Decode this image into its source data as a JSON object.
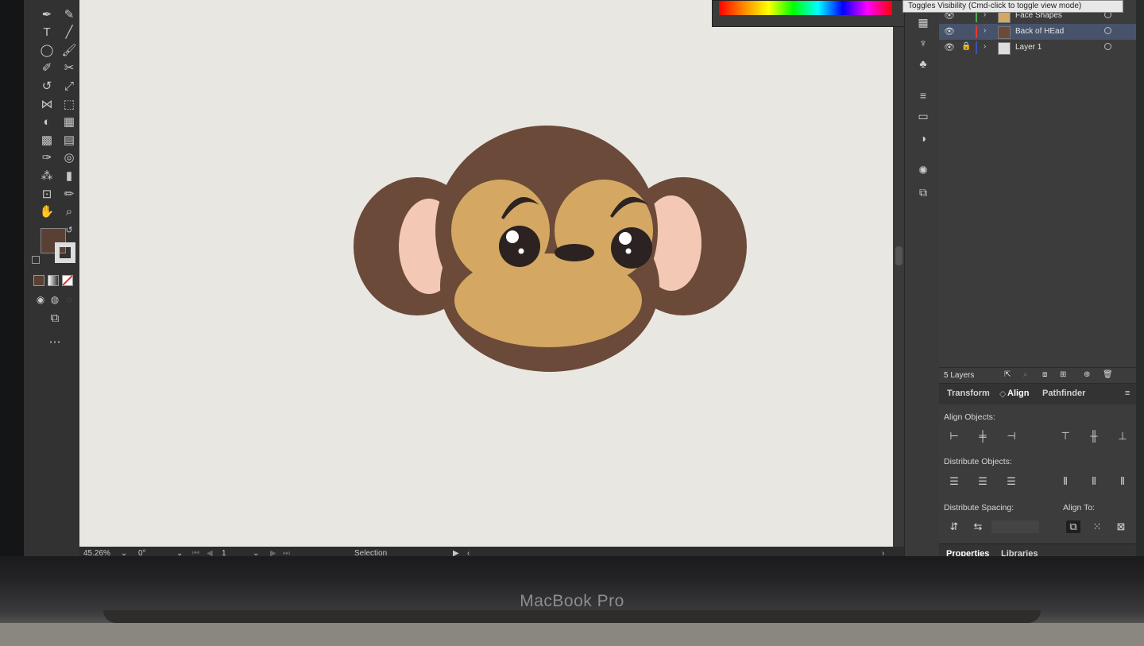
{
  "device": {
    "brand": "MacBook Pro"
  },
  "tooltip": {
    "text": "Toggles Visibility (Cmd-click to toggle view mode)"
  },
  "tools": [
    {
      "name": "pen-icon",
      "glyph": "✒"
    },
    {
      "name": "curvature-icon",
      "glyph": "✎"
    },
    {
      "name": "type-icon",
      "glyph": "T"
    },
    {
      "name": "line-icon",
      "glyph": "╱"
    },
    {
      "name": "ellipse-icon",
      "glyph": "◯"
    },
    {
      "name": "paintbrush-icon",
      "glyph": "🖌"
    },
    {
      "name": "shaper-icon",
      "glyph": "✐"
    },
    {
      "name": "scissors-icon",
      "glyph": "✂"
    },
    {
      "name": "rotate-icon",
      "glyph": "↺"
    },
    {
      "name": "scale-icon",
      "glyph": "⤢"
    },
    {
      "name": "width-icon",
      "glyph": "⋈"
    },
    {
      "name": "free-transform-icon",
      "glyph": "⬚"
    },
    {
      "name": "shape-builder-icon",
      "glyph": "◐"
    },
    {
      "name": "perspective-icon",
      "glyph": "▦"
    },
    {
      "name": "mesh-icon",
      "glyph": "▩"
    },
    {
      "name": "gradient-icon",
      "glyph": "▤"
    },
    {
      "name": "eyedropper-icon",
      "glyph": "✑"
    },
    {
      "name": "blend-icon",
      "glyph": "◎"
    },
    {
      "name": "symbol-sprayer-icon",
      "glyph": "⁂"
    },
    {
      "name": "graph-icon",
      "glyph": "▮"
    },
    {
      "name": "artboard-icon",
      "glyph": "⊡"
    },
    {
      "name": "slice-icon",
      "glyph": "✏"
    },
    {
      "name": "hand-icon",
      "glyph": "✋"
    },
    {
      "name": "zoom-icon",
      "glyph": "⌕"
    }
  ],
  "colors": {
    "fill": "#5a4034",
    "head": "#6b4a3a",
    "face": "#d4a862",
    "ear_inner": "#f3c8b4",
    "eye": "#2b2221",
    "canvas": "#e9e7e2"
  },
  "status": {
    "zoom": "45.26%",
    "rotation": "0°",
    "artboard": "1",
    "tool": "Selection"
  },
  "layers": {
    "items": [
      {
        "name": "Face Shapes",
        "color": "#4caf50",
        "selected": false,
        "locked": false
      },
      {
        "name": "Back of HEad",
        "color": "#e53935",
        "selected": true,
        "locked": false
      },
      {
        "name": "Layer 1",
        "color": "#3f51b5",
        "selected": false,
        "locked": true
      }
    ],
    "count_label": "5 Layers"
  },
  "align_panel": {
    "tabs": [
      "Transform",
      "Align",
      "Pathfinder"
    ],
    "active_tab": "Align",
    "align_objects_label": "Align Objects:",
    "distribute_objects_label": "Distribute Objects:",
    "distribute_spacing_label": "Distribute Spacing:",
    "align_to_label": "Align To:"
  },
  "bottom_tabs": [
    "Properties",
    "Libraries"
  ]
}
